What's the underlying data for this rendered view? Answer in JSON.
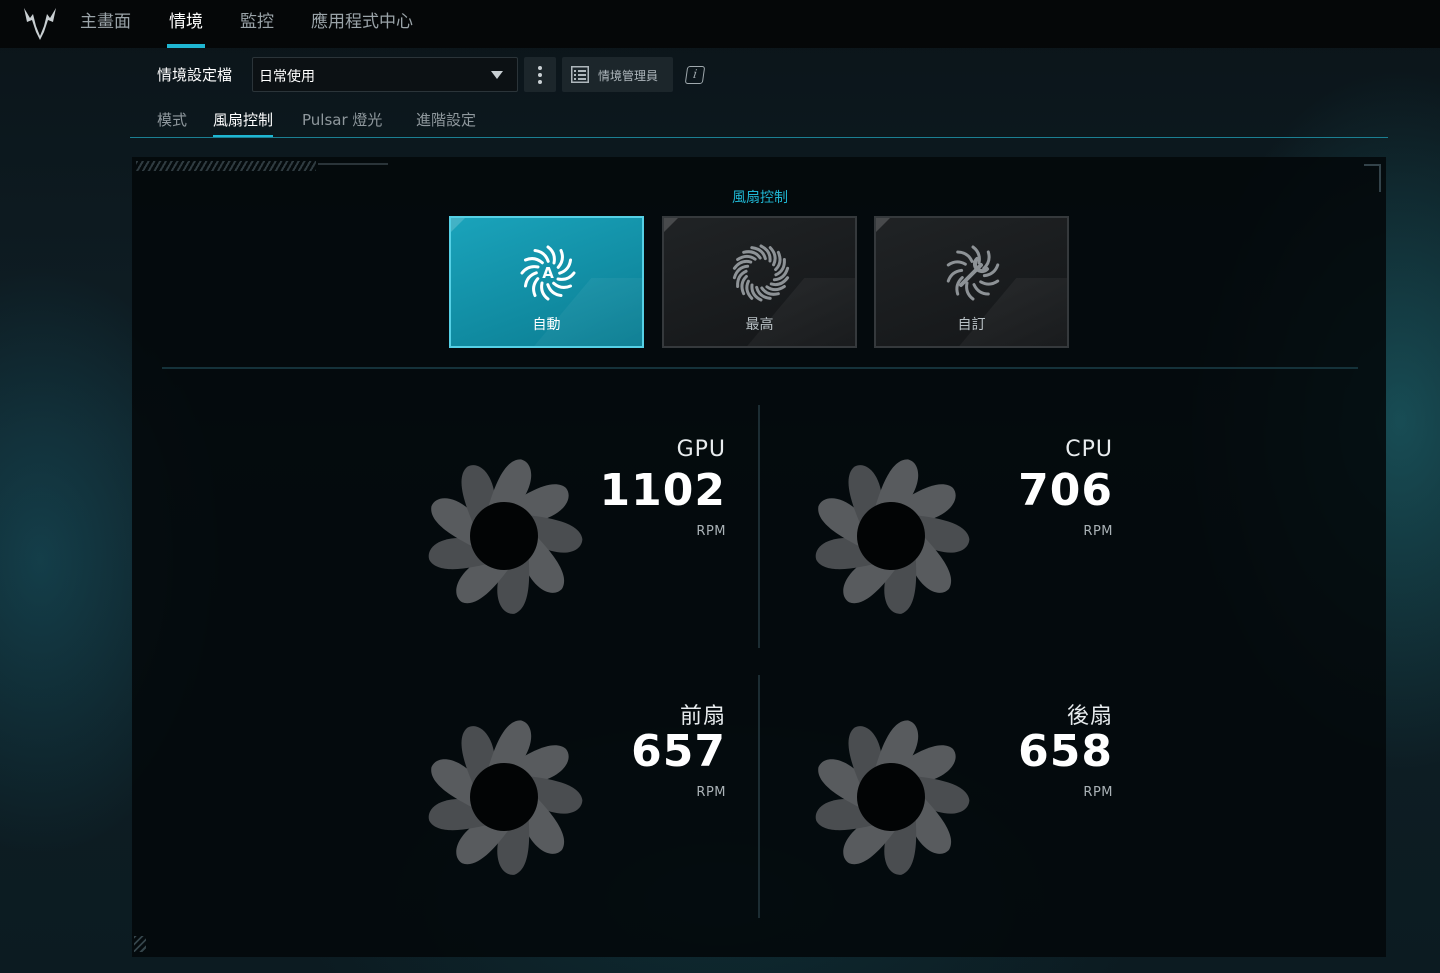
{
  "nav": {
    "tabs": [
      {
        "label": "主畫面"
      },
      {
        "label": "情境"
      },
      {
        "label": "監控"
      },
      {
        "label": "應用程式中心"
      }
    ]
  },
  "profile": {
    "label": "情境設定檔",
    "selected": "日常使用",
    "manager_label": "情境管理員",
    "info_glyph": "i"
  },
  "subtabs": [
    {
      "label": "模式"
    },
    {
      "label": "風扇控制"
    },
    {
      "label": "Pulsar 燈光"
    },
    {
      "label": "進階設定"
    }
  ],
  "fan_control": {
    "title": "風扇控制",
    "modes": [
      {
        "label": "自動",
        "icon": "auto-fan-icon",
        "glyph": "A"
      },
      {
        "label": "最高",
        "icon": "max-fan-icon"
      },
      {
        "label": "自訂",
        "icon": "custom-fan-icon"
      }
    ],
    "fans": [
      {
        "name": "GPU",
        "rpm": "1102",
        "unit": "RPM"
      },
      {
        "name": "CPU",
        "rpm": "706",
        "unit": "RPM"
      },
      {
        "name": "前扇",
        "rpm": "657",
        "unit": "RPM"
      },
      {
        "name": "後扇",
        "rpm": "658",
        "unit": "RPM"
      }
    ]
  },
  "colors": {
    "accent": "#1fb6d2",
    "active_card": "#1aa3bb"
  }
}
